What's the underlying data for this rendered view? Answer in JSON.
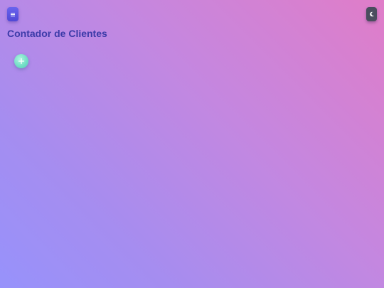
{
  "header": {
    "menu_icon": "hamburger-menu-icon",
    "theme_icon": "moon-icon",
    "title": "Contador de Clientes"
  },
  "actions": {
    "add_icon": "plus-icon"
  },
  "colors": {
    "menu_button": "#5a52e0",
    "theme_button": "#4a4d5e",
    "title_text": "#3b3aa8",
    "add_button": "#7ee3c9",
    "background_start": "#9792fb",
    "background_end": "#e07dc8"
  }
}
